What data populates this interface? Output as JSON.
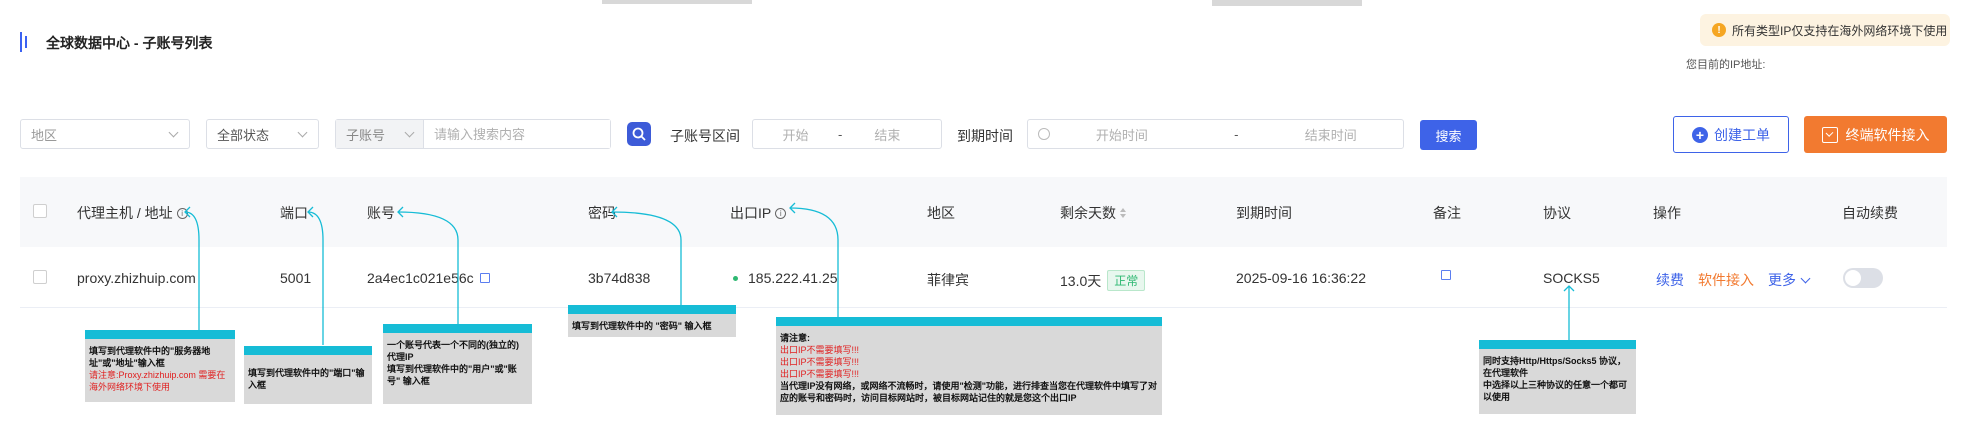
{
  "header": {
    "title": "全球数据中心 - 子账号列表",
    "notice": "所有类型IP仅支持在海外网络环境下使用",
    "ip_label": "您目前的IP地址:"
  },
  "filters": {
    "region_placeholder": "地区",
    "status_value": "全部状态",
    "account_select": "子账号",
    "search_placeholder": "请输入搜索内容",
    "range_label": "子账号区间",
    "range_start": "开始",
    "range_sep": "-",
    "range_end": "结束",
    "expire_label": "到期时间",
    "expire_start": "开始时间",
    "expire_end": "结束时间",
    "search_button": "搜索",
    "create_ticket": "创建工单",
    "terminal_access": "终端软件接入"
  },
  "table": {
    "headers": {
      "host": "代理主机 / 地址",
      "port": "端口",
      "account": "账号",
      "password": "密码",
      "exit_ip": "出口IP",
      "region": "地区",
      "days_left": "剩余天数",
      "expire_time": "到期时间",
      "remark": "备注",
      "protocol": "协议",
      "actions": "操作",
      "auto_renew": "自动续费"
    },
    "rows": [
      {
        "host": "proxy.zhizhuip.com",
        "port": "5001",
        "account": "2a4ec1c021e56c",
        "password": "3b74d838",
        "exit_ip": "185.222.41.25",
        "region": "菲律宾",
        "days_left": "13.0天",
        "status": "正常",
        "expire_time": "2025-09-16 16:36:22",
        "protocol": "SOCKS5",
        "action_renew": "续费",
        "action_software": "软件接入",
        "action_more": "更多"
      }
    ]
  },
  "annotations": {
    "host": {
      "line1": "填写到代理软件中的\"服务器地址\"或\"地址\"输入框",
      "warn": "请注意:Proxy.zhizhuip.com 需要在海外网络环境下使用"
    },
    "port": {
      "line1": "填写到代理软件中的\"端口\"输入框"
    },
    "account": {
      "line1": "一个账号代表一个不同的(独立的) 代理IP",
      "line2": "填写到代理软件中的\"用户\"或\"账号\" 输入框"
    },
    "password": {
      "line1": "填写到代理软件中的 \"密码\" 输入框"
    },
    "exit_ip": {
      "title": "请注意:",
      "warn1": "出口IP不需要填写!!!",
      "warn2": "出口IP不需要填写!!!",
      "warn3": "出口IP不需要填写!!!",
      "body": "当代理IP没有网络，或网络不流畅时，请使用\"检测\"功能，进行排查当您在代理软件中填写了对应的账号和密码时，访问目标网站时，被目标网站记住的就是您这个出口IP"
    },
    "protocol": {
      "line1": "同时支持Http/Https/Socks5 协议，在代理软件",
      "line2": "中选择以上三种协议的任意一个都可以使用"
    }
  },
  "colors": {
    "primary": "#3e63e8",
    "orange": "#f27a30",
    "cyan": "#16bcd6",
    "success": "#2eb872",
    "warn_red": "#e02020"
  }
}
